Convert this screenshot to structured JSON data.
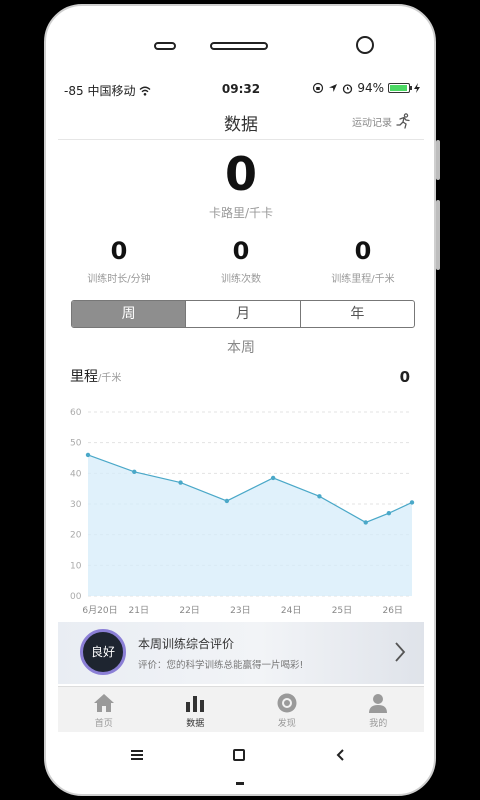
{
  "statusbar": {
    "signal": "-85",
    "carrier": "中国移动",
    "time": "09:32",
    "battery": "94%"
  },
  "header": {
    "title": "数据",
    "record_label": "运动记录"
  },
  "summary": {
    "calories": "0",
    "calories_unit": "卡路里/千卡",
    "stats": [
      {
        "value": "0",
        "label": "训练时长/分钟"
      },
      {
        "value": "0",
        "label": "训练次数"
      },
      {
        "value": "0",
        "label": "训练里程/千米"
      }
    ]
  },
  "period": {
    "tabs": [
      "周",
      "月",
      "年"
    ],
    "active": 0,
    "current_label": "本周"
  },
  "distance": {
    "title": "里程",
    "unit": "/千米",
    "value": "0"
  },
  "chart_data": {
    "type": "line",
    "categories": [
      "6月20日",
      "21日",
      "22日",
      "23日",
      "24日",
      "25日",
      "26日"
    ],
    "x": [
      0,
      0.5,
      1,
      1.5,
      2,
      2.5,
      3,
      3.5,
      4,
      4.5,
      5,
      5.5,
      6
    ],
    "values": [
      46,
      null,
      40.5,
      null,
      37,
      null,
      31,
      null,
      38.5,
      null,
      32.5,
      null,
      24,
      null,
      27,
      null,
      30.5
    ],
    "points": [
      {
        "x": 0,
        "y": 46
      },
      {
        "x": 1,
        "y": 40.5
      },
      {
        "x": 2,
        "y": 37
      },
      {
        "x": 3,
        "y": 31
      },
      {
        "x": 4,
        "y": 38.5
      },
      {
        "x": 5,
        "y": 32.5
      },
      {
        "x": 6,
        "y": 24
      },
      {
        "x": 6.5,
        "y": 27
      },
      {
        "x": 7,
        "y": 30.5
      }
    ],
    "yticks": [
      "00",
      "10",
      "20",
      "30",
      "40",
      "50",
      "60"
    ],
    "ylim": [
      0,
      60
    ],
    "grid": true,
    "colors": {
      "line": "#4aa8c8",
      "fill": "#d6ecfa"
    }
  },
  "evaluation": {
    "badge": "良好",
    "title": "本周训练综合评价",
    "subtitle": "评价：您的科学训练总能赢得一片喝彩!"
  },
  "tabbar": {
    "items": [
      {
        "label": "首页",
        "icon": "home-icon"
      },
      {
        "label": "数据",
        "icon": "bar-chart-icon"
      },
      {
        "label": "发现",
        "icon": "discover-icon"
      },
      {
        "label": "我的",
        "icon": "profile-icon"
      }
    ],
    "active": 1
  }
}
